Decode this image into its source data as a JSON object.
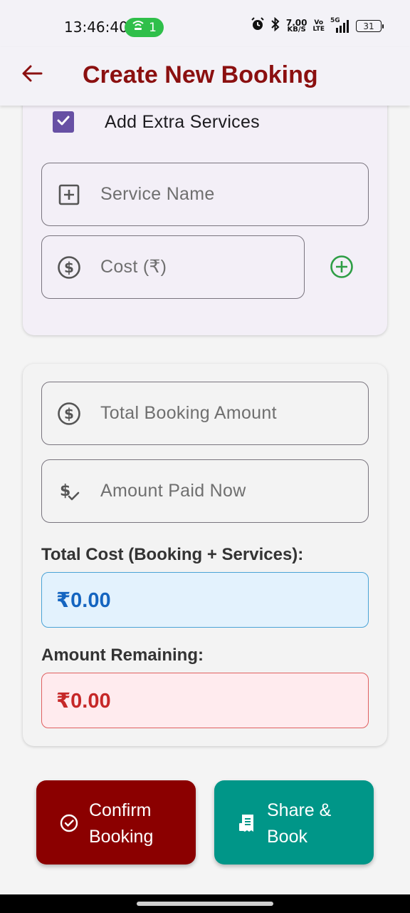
{
  "status_bar": {
    "time": "13:46:40",
    "hotspot_count": "1",
    "net_speed_value": "7.00",
    "net_speed_unit": "KB/S",
    "volte_top": "Vo",
    "volte_bottom": "LTE",
    "network": "5G",
    "battery": "31",
    "icons": [
      "hotspot-icon",
      "alarm-icon",
      "bluetooth-icon",
      "signal-icon",
      "battery-icon"
    ]
  },
  "app_bar": {
    "title": "Create New Booking",
    "back_icon": "arrow-back-icon"
  },
  "extra_services": {
    "checkbox_label": "Add Extra Services",
    "checked": true,
    "service_name_placeholder": "Service Name",
    "service_name_value": "",
    "cost_placeholder": "Cost (₹)",
    "cost_value": "",
    "add_icon": "add-circle-icon"
  },
  "totals": {
    "total_booking_placeholder": "Total Booking Amount",
    "total_booking_value": "",
    "amount_paid_placeholder": "Amount Paid Now",
    "amount_paid_value": "",
    "total_cost_label": "Total Cost (Booking + Services):",
    "total_cost_value": "₹0.00",
    "remaining_label": "Amount Remaining:",
    "remaining_value": "₹0.00"
  },
  "actions": {
    "confirm_line1": "Confirm",
    "confirm_line2": "Booking",
    "share_line1": "Share &",
    "share_line2": "Book"
  },
  "colors": {
    "title": "#8b1010",
    "confirm_button": "#8b0000",
    "share_button": "#009688",
    "checkbox": "#6750a4",
    "add_icon": "#2e9e45",
    "total_value": "#1565c0",
    "remaining_value": "#c62828"
  }
}
